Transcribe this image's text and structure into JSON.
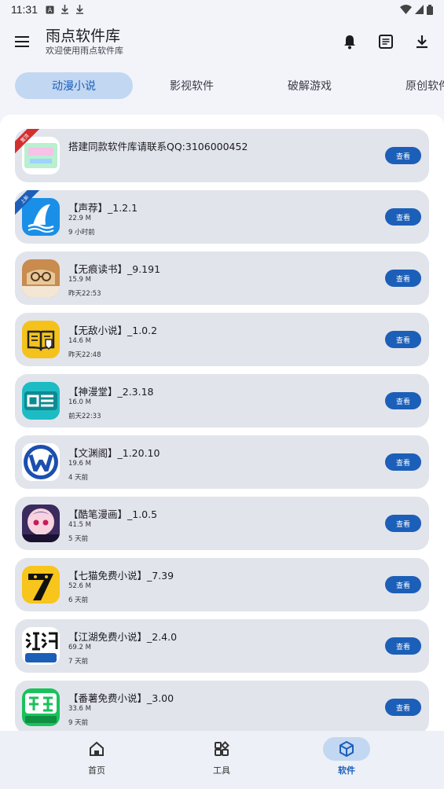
{
  "status_bar": {
    "time": "11:31"
  },
  "header": {
    "title": "雨点软件库",
    "subtitle": "欢迎使用雨点软件库",
    "actions": [
      "bell-icon",
      "notes-icon",
      "download-icon"
    ]
  },
  "tabs": [
    {
      "label": "动漫小说",
      "active": true
    },
    {
      "label": "影视软件",
      "active": false
    },
    {
      "label": "破解游戏",
      "active": false
    },
    {
      "label": "原创软件",
      "active": false
    }
  ],
  "apps": [
    {
      "name": "搭建同款软件库请联系QQ:3106000452",
      "size": "",
      "time": "",
      "badge": "置顶",
      "button": "查看",
      "icon_bg": "#ffffff"
    },
    {
      "name": "【声荐】_1.2.1",
      "size": "22.9 M",
      "time": "9 小时前",
      "badge": "上新",
      "button": "查看",
      "icon_bg": "#1a8fe8"
    },
    {
      "name": "【无痕读书】_9.191",
      "size": "15.9 M",
      "time": "昨天22:53",
      "badge": "",
      "button": "查看",
      "icon_bg": "#c98b4e"
    },
    {
      "name": "【无敌小说】_1.0.2",
      "size": "14.6 M",
      "time": "昨天22:48",
      "badge": "",
      "button": "查看",
      "icon_bg": "#f5c21c"
    },
    {
      "name": "【神漫堂】_2.3.18",
      "size": "16.0 M",
      "time": "前天22:33",
      "badge": "",
      "button": "查看",
      "icon_bg": "#1dbcc4"
    },
    {
      "name": "【文渊阁】_1.20.10",
      "size": "19.6 M",
      "time": "4 天前",
      "badge": "",
      "button": "查看",
      "icon_bg": "#ffffff"
    },
    {
      "name": "【酷笔漫画】_1.0.5",
      "size": "41.5 M",
      "time": "5 天前",
      "badge": "",
      "button": "查看",
      "icon_bg": "#3b2a5e"
    },
    {
      "name": "【七猫免费小说】_7.39",
      "size": "52.6 M",
      "time": "6 天前",
      "badge": "",
      "button": "查看",
      "icon_bg": "#f7c51b"
    },
    {
      "name": "【江湖免费小说】_2.4.0",
      "size": "69.2 M",
      "time": "7 天前",
      "badge": "",
      "button": "查看",
      "icon_bg": "#ffffff"
    },
    {
      "name": "【番薯免费小说】_3.00",
      "size": "33.6 M",
      "time": "9 天前",
      "badge": "",
      "button": "查看",
      "icon_bg": "#19c25b"
    }
  ],
  "bottom_nav": [
    {
      "label": "首页",
      "icon": "home-icon",
      "active": false
    },
    {
      "label": "工具",
      "icon": "tools-grid-icon",
      "active": false
    },
    {
      "label": "软件",
      "icon": "cube-icon",
      "active": true
    }
  ],
  "colors": {
    "accent": "#1c5fb8",
    "pill": "#c2d7f2",
    "card": "#e2e4ec",
    "badge_red": "#d32f2f",
    "badge_blue": "#1c5fb8"
  }
}
